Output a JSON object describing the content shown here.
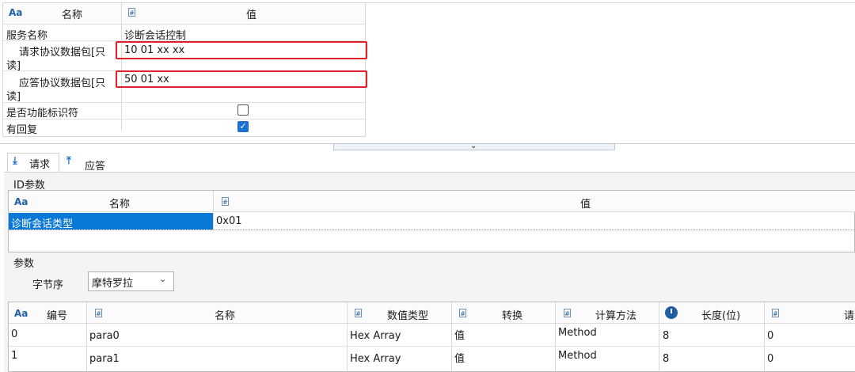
{
  "props": {
    "header": {
      "name_col": "名称",
      "value_col": "值",
      "aa": "Aa",
      "hash": "#"
    },
    "rows": [
      {
        "label": "服务名称",
        "value": "诊断会话控制"
      },
      {
        "label_line1": "请求协议数据包[只",
        "label_line2": "读]",
        "value": "10 01 xx xx"
      },
      {
        "label_line1": "应答协议数据包[只",
        "label_line2": "读]",
        "value": "50 01 xx"
      },
      {
        "label": "是否功能标识符",
        "checked": false
      },
      {
        "label": "有回复",
        "checked": true
      }
    ]
  },
  "tabs": [
    {
      "label": "请求",
      "icon": "arrow-down-to-line-icon",
      "active": true
    },
    {
      "label": "应答",
      "icon": "arrow-up-from-line-icon",
      "active": false
    }
  ],
  "id_params": {
    "title": "ID参数",
    "header": {
      "aa": "Aa",
      "name_col": "名称",
      "hash": "#",
      "value_col": "值"
    },
    "rows": [
      {
        "name": "诊断会话类型",
        "value": "0x01"
      }
    ]
  },
  "params": {
    "title": "参数",
    "byte_order_label": "字节序",
    "byte_order_value": "摩特罗拉",
    "header": [
      "编号",
      "名称",
      "数值类型",
      "转换",
      "计算方法",
      "长度(位)",
      "请"
    ],
    "rows": [
      [
        "0",
        "para0",
        "Hex Array",
        "值",
        "Method",
        "8",
        "0"
      ],
      [
        "1",
        "para1",
        "Hex Array",
        "值",
        "Method",
        "8",
        "0"
      ]
    ]
  },
  "colors": {
    "highlight_red": "#e0202a",
    "selection_blue": "#0a78d7",
    "checkbox_blue": "#1e6fd0"
  }
}
